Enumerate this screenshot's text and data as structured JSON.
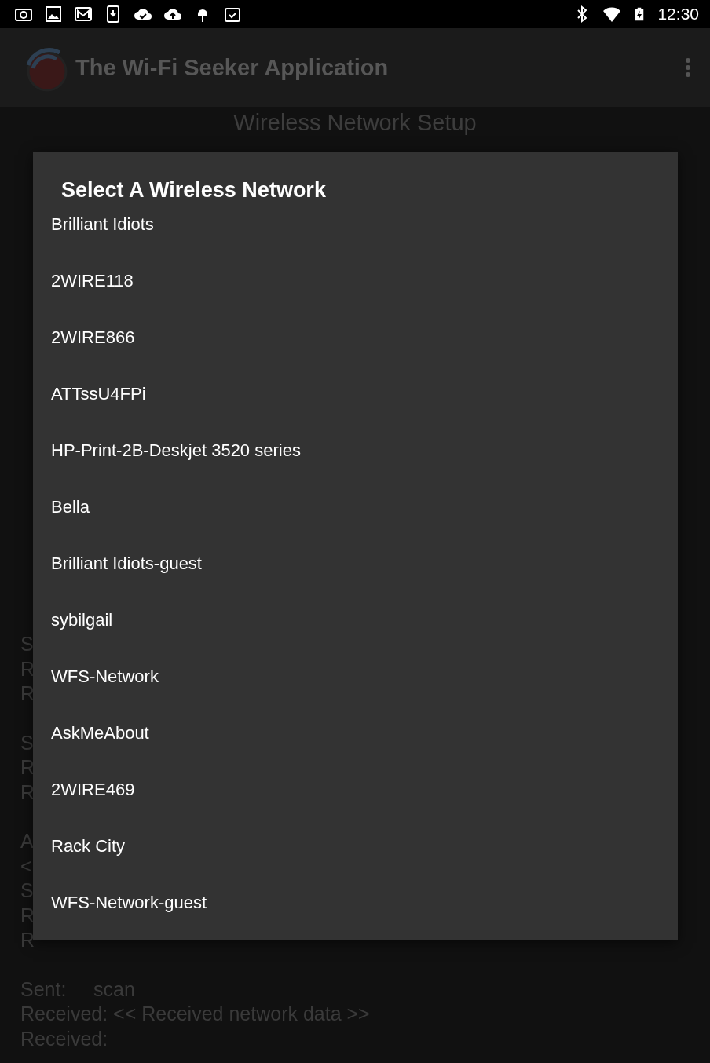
{
  "status_bar": {
    "time": "12:30",
    "battery_charging": true
  },
  "app_bar": {
    "title": "The Wi-Fi Seeker Application"
  },
  "setup": {
    "title": "Wireless Network Setup"
  },
  "log_groups": [
    {
      "lines": [
        "S",
        "R",
        "R"
      ]
    },
    {
      "lines": [
        "S",
        "R",
        "R"
      ]
    },
    {
      "lines": [
        "A",
        "<",
        "S",
        "R",
        "R"
      ]
    },
    {
      "lines": [
        "Sent:     scan",
        "Received: << Received network data >>",
        "Received:"
      ]
    }
  ],
  "dialog": {
    "title": "Select A Wireless Network",
    "networks": [
      {
        "name": "Brilliant Idiots"
      },
      {
        "name": "2WIRE118"
      },
      {
        "name": "2WIRE866"
      },
      {
        "name": "ATTssU4FPi"
      },
      {
        "name": "HP-Print-2B-Deskjet 3520 series"
      },
      {
        "name": "Bella"
      },
      {
        "name": "Brilliant Idiots-guest"
      },
      {
        "name": "sybilgail"
      },
      {
        "name": "WFS-Network"
      },
      {
        "name": "AskMeAbout"
      },
      {
        "name": "2WIRE469"
      },
      {
        "name": "Rack City"
      },
      {
        "name": "WFS-Network-guest"
      }
    ]
  }
}
